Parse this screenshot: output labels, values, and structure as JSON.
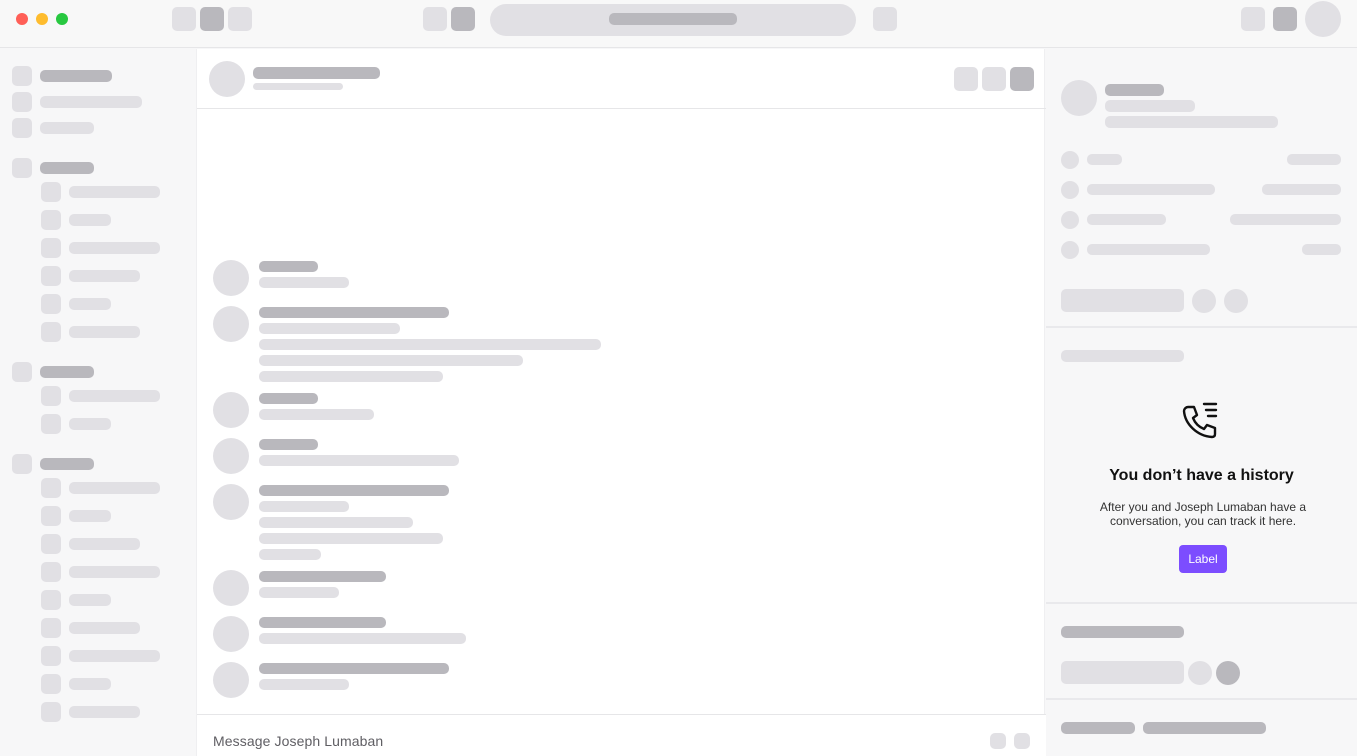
{
  "window": {
    "traffic_lights": {
      "close": "#ff5f57",
      "minimize": "#febc2e",
      "maximize": "#28c840"
    }
  },
  "colors": {
    "accent": "#7c4dff",
    "skeleton_light": "#e1e0e4",
    "skeleton_dark": "#b9b8bd"
  },
  "history_panel": {
    "icon": "phone-history-icon",
    "title": "You don’t have a history",
    "description": "After you and Joseph Lumaban have a conversation, you can track it here.",
    "button_label": "Label"
  },
  "composer": {
    "placeholder": "Message Joseph Lumaban"
  }
}
